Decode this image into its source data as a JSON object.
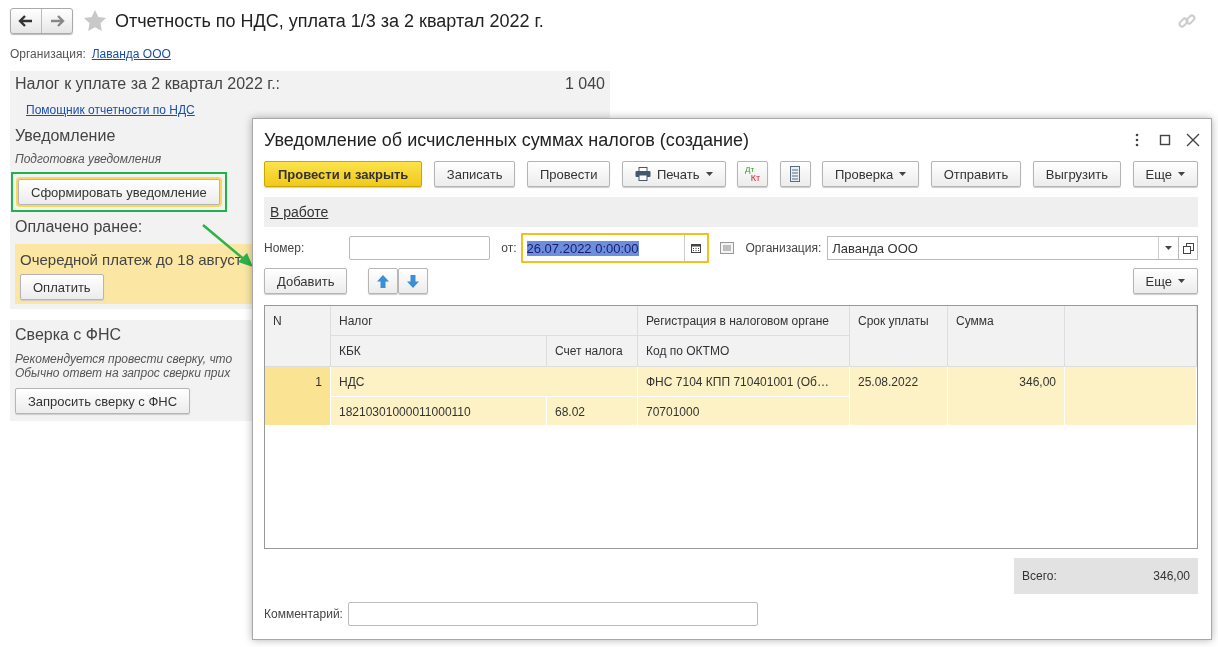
{
  "page": {
    "title": "Отчетность по НДС, уплата 1/3 за 2 квартал 2022 г.",
    "organization_label": "Организация:",
    "organization": "Лаванда ООО"
  },
  "tax_panel": {
    "label": "Налог к уплате за 2 квартал 2022 г.:",
    "amount": "1 040",
    "assistant_link": "Помощник отчетности по НДС",
    "notification_heading": "Уведомление",
    "notification_note": "Подготовка уведомления",
    "create_button": "Сформировать уведомление",
    "create_highlighted": true,
    "paid_heading": "Оплачено ранее:",
    "payment_note": "Очередной платеж до 18 август",
    "pay_button": "Оплатить"
  },
  "reconciliation": {
    "heading": "Сверка с ФНС",
    "lines": [
      "Рекомендуется провести сверку, что",
      "Обычно ответ на запрос сверки прих"
    ],
    "button": "Запросить сверку с ФНС"
  },
  "dialog": {
    "title": "Уведомление об исчисленных суммах налогов (создание)",
    "toolbar": [
      {
        "kind": "primary",
        "label": "Провести и закрыть"
      },
      {
        "kind": "plain",
        "label": "Записать"
      },
      {
        "kind": "plain",
        "label": "Провести"
      },
      {
        "kind": "print",
        "label": "Печать"
      },
      {
        "kind": "dtkt",
        "top": "Дт",
        "bottom": "Кт"
      },
      {
        "kind": "list"
      },
      {
        "kind": "menu",
        "label": "Проверка"
      },
      {
        "kind": "plain",
        "label": "Отправить"
      },
      {
        "kind": "plain",
        "label": "Выгрузить"
      },
      {
        "kind": "menu",
        "label": "Еще"
      }
    ],
    "status_link": "В работе",
    "number_label": "Номер:",
    "date_label": "от:",
    "date_value": "26.07.2022  0:00:00",
    "date_focused": true,
    "organization_label": "Организация:",
    "organization_value": "Лаванда ООО",
    "add_button": "Добавить",
    "more_button": "Еще",
    "columns": {
      "n": "N",
      "tax": "Налог",
      "kbk": "КБК",
      "account": "Счет налога",
      "registration": "Регистрация в налоговом органе",
      "oktmo": "Код по ОКТМО",
      "due": "Срок уплаты",
      "sum": "Сумма"
    },
    "rows": [
      {
        "n": "1",
        "tax": "НДС",
        "kbk": "18210301000011000110",
        "account": "68.02",
        "registration": "ФНС 7104 КПП 710401001 (Об…",
        "oktmo": "70701000",
        "due": "25.08.2022",
        "sum": "346,00",
        "selected": true
      }
    ],
    "total_label": "Всего:",
    "total_value": "346,00",
    "comment_label": "Комментарий:"
  }
}
